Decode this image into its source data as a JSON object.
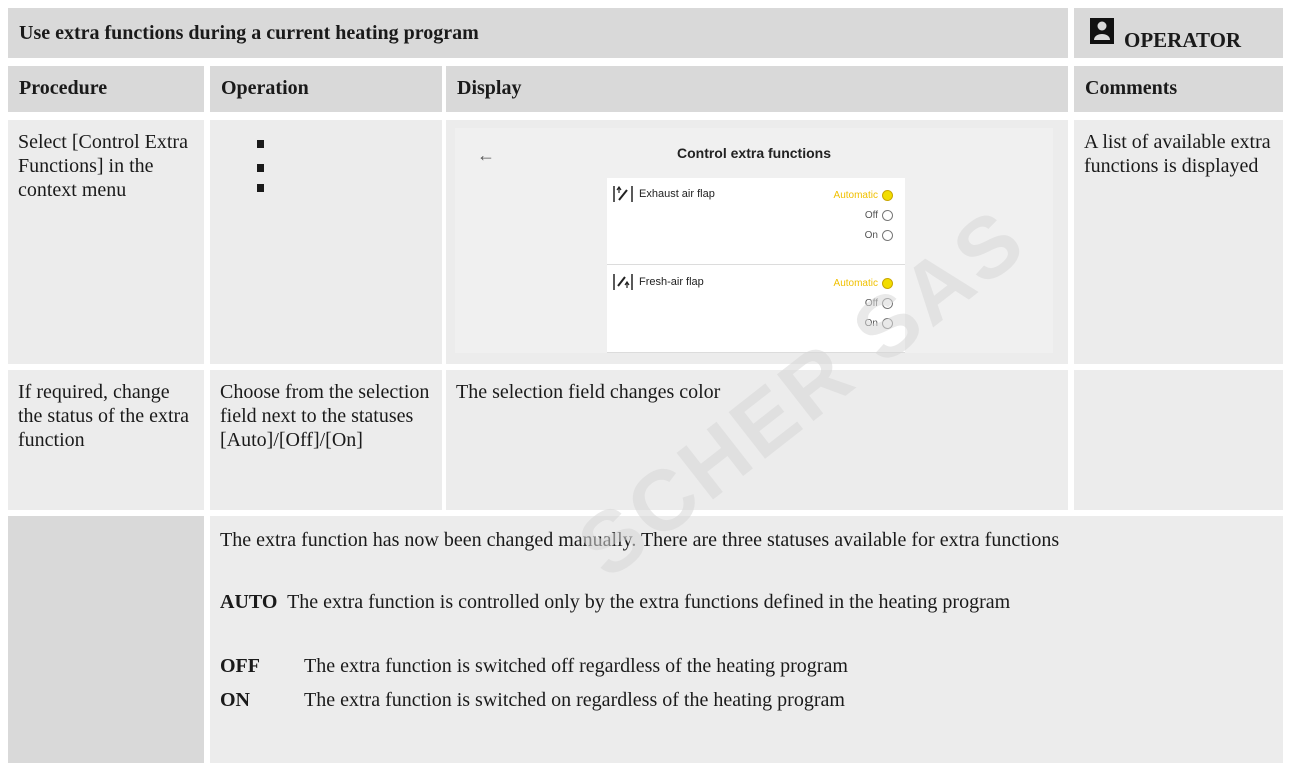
{
  "title": "Use extra functions during a current heating program",
  "role_label": "OPERATOR",
  "columns": [
    "Procedure",
    "Operation",
    "Display",
    "Comments"
  ],
  "row1": {
    "procedure": "Select [Control Extra Functions] in the context menu",
    "operation_icon": "vertical-ellipsis-icon",
    "comment": "A list of available extra functions is displayed",
    "screen": {
      "back": "←",
      "title": "Control extra functions",
      "items": [
        {
          "name": "Exhaust air flap",
          "icon": "exhaust-air-flap-icon",
          "options": [
            "Automatic",
            "Off",
            "On"
          ],
          "selected": "Automatic"
        },
        {
          "name": "Fresh-air flap",
          "icon": "fresh-air-flap-icon",
          "options": [
            "Automatic",
            "Off",
            "On"
          ],
          "selected": "Automatic"
        }
      ]
    }
  },
  "row2": {
    "procedure": "If required, change the status of the extra function",
    "operation": "Choose from the selection field next to the statuses [Auto]/[Off]/[On]",
    "display": "The selection field changes color"
  },
  "row3": {
    "intro": "The extra function has now been changed manually. There are three statuses available for extra functions",
    "statuses": [
      {
        "key": "AUTO",
        "text": "The extra function is controlled only by the extra functions defined in the heating program"
      },
      {
        "key": "OFF",
        "text": "The extra function is switched off regardless of the heating program"
      },
      {
        "key": "ON",
        "text": "The extra function is switched on regardless of the heating program"
      }
    ]
  },
  "watermark": "SCHER SAS",
  "colors": {
    "header_gray": "#d9d9d9",
    "light_gray": "#ececec",
    "selected_yellow": "#f2dd00"
  }
}
